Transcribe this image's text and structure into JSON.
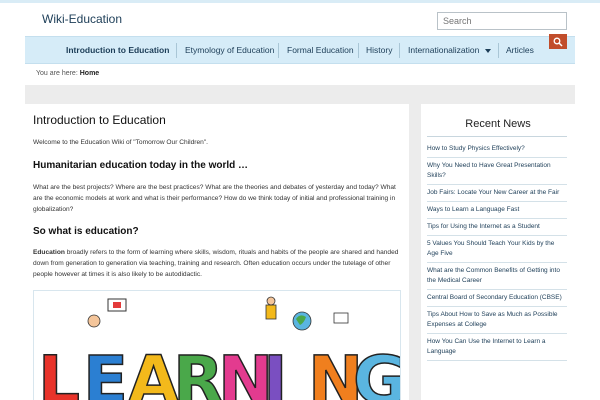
{
  "site": {
    "title": "Wiki-Education"
  },
  "search": {
    "placeholder": "Search"
  },
  "nav": {
    "items": [
      {
        "label": "Introduction to Education"
      },
      {
        "label": "Etymology of Education"
      },
      {
        "label": "Formal Education"
      },
      {
        "label": "History"
      },
      {
        "label": "Internationalization"
      },
      {
        "label": "Articles"
      }
    ]
  },
  "breadcrumb": {
    "prefix": "You are here:",
    "current": "Home"
  },
  "main": {
    "title": "Introduction to Education",
    "intro": "Welcome to the Education Wiki of \"Tomorrow Our Children\".",
    "h2_1": "Humanitarian education today in the world …",
    "p2": "What are the best projects? Where are the best practices? What are the theories and debates of yesterday and today? What are the economic models at work and what is their performance? How do we think today of initial and professional training in globalization?",
    "h2_2": "So what is education?",
    "p3_strong": "Education",
    "p3_rest": " broadly refers to the form of learning where skills, wisdom, rituals and habits of the people are shared and handed down from generation to generation via teaching, training and research. Often education occurs under the tutelage of other people however at times it is also likely to be autodidactic.",
    "image_letters": [
      "L",
      "E",
      "A",
      "R",
      "N",
      "I",
      "N",
      "G"
    ],
    "letter_colors": [
      "#e8332a",
      "#2b7fd2",
      "#f3b91b",
      "#4aa84a",
      "#e33b8f",
      "#7a4fc1",
      "#f07f1e",
      "#5ab5e0"
    ]
  },
  "sidebar": {
    "title": "Recent News",
    "items": [
      "How to Study Physics Effectively?",
      "Why You Need to Have Great Presentation Skills?",
      "Job Fairs: Locate Your New Career at the Fair",
      "Ways to Learn a Language Fast",
      "Tips for Using the Internet as a Student",
      "5 Values You Should Teach Your Kids by the Age Five",
      "What are the Common Benefits of Getting into the Medical Career",
      "Central Board of Secondary Education (CBSE)",
      "Tips About How to Save as Much as Possible Expenses at College",
      "How You Can Use the Internet to Learn a Language"
    ]
  }
}
